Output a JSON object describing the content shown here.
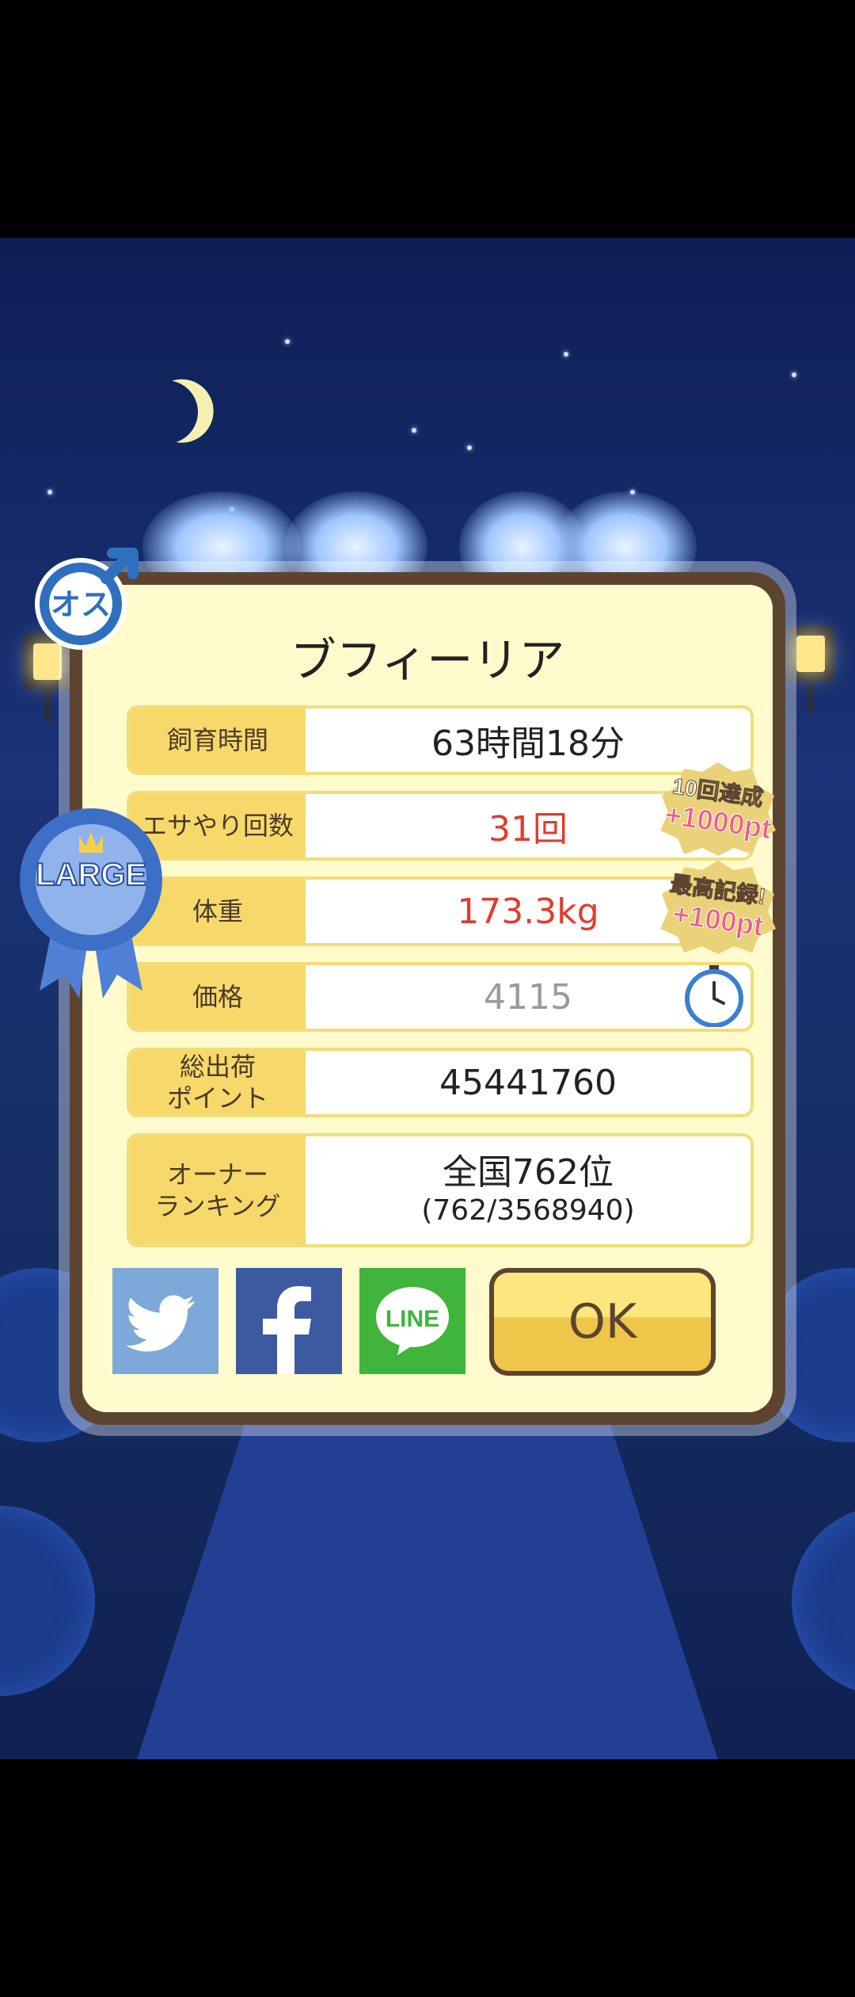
{
  "dialog": {
    "title": "ブフィーリア",
    "rows": [
      {
        "label": "飼育時間",
        "value": "63時間18分"
      },
      {
        "label": "エサやり回数",
        "value": "31回"
      },
      {
        "label": "体重",
        "value": "173.3kg"
      },
      {
        "label": "価格",
        "value": "4115"
      },
      {
        "label": "総出荷\nポイント",
        "value": "45441760"
      },
      {
        "label": "オーナー\nランキング",
        "value": "全国762位",
        "sub": "(762/3568940)"
      }
    ],
    "ok_label": "OK",
    "share": {
      "line_label": "LINE"
    }
  },
  "badges": {
    "gender": "オス",
    "size_ribbon": "LARGE",
    "bonus1": {
      "top": "10回達成",
      "bottom": "+1000pt"
    },
    "bonus2": {
      "top": "最高記録!",
      "bottom": "+100pt"
    }
  },
  "colors": {
    "highlight": "#e23b2e",
    "panel": "#fffbcc",
    "frame": "#5d4430",
    "label_bg": "#f6d96a"
  }
}
